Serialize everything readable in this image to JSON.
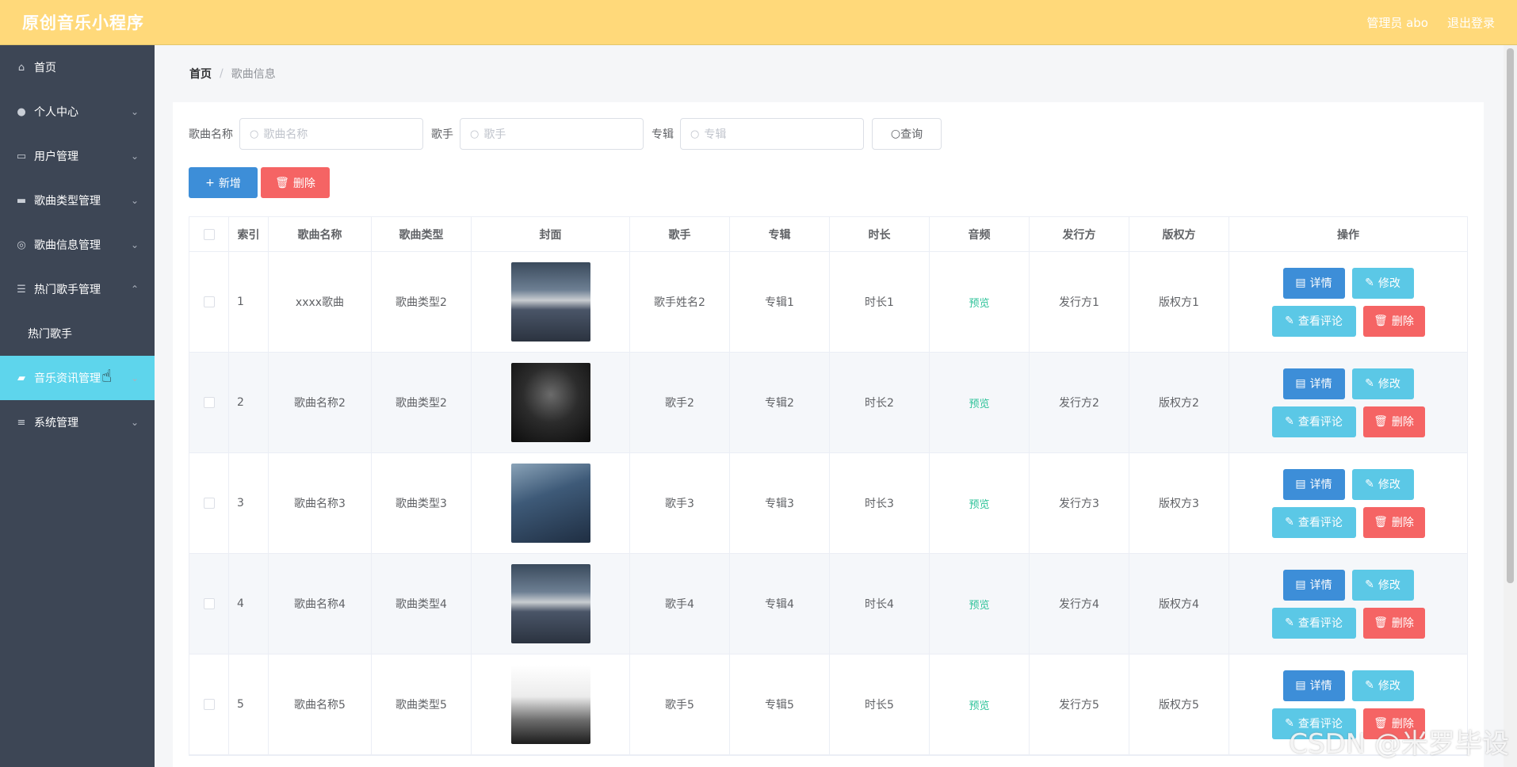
{
  "header": {
    "title": "原创音乐小程序",
    "user": "管理员 abo",
    "logout": "退出登录"
  },
  "sidebar": {
    "items": [
      {
        "label": "首页",
        "icon": "home-icon"
      },
      {
        "label": "个人中心",
        "icon": "user-icon"
      },
      {
        "label": "用户管理",
        "icon": "id-card-icon"
      },
      {
        "label": "歌曲类型管理",
        "icon": "flag-icon"
      },
      {
        "label": "歌曲信息管理",
        "icon": "compass-icon"
      },
      {
        "label": "热门歌手管理",
        "icon": "sliders-icon"
      },
      {
        "label": "音乐资讯管理",
        "icon": "wallet-icon"
      },
      {
        "label": "系统管理",
        "icon": "menu-icon"
      }
    ],
    "submenu": {
      "label": "热门歌手"
    },
    "active_item": "音乐资讯管理"
  },
  "breadcrumb": {
    "home": "首页",
    "separator": "/",
    "current": "歌曲信息"
  },
  "search": {
    "song_label": "歌曲名称",
    "song_placeholder": "歌曲名称",
    "singer_label": "歌手",
    "singer_placeholder": "歌手",
    "album_label": "专辑",
    "album_placeholder": "专辑",
    "query_button": "查询"
  },
  "actions": {
    "add": "新增",
    "delete": "删除"
  },
  "table": {
    "headers": [
      "索引",
      "歌曲名称",
      "歌曲类型",
      "封面",
      "歌手",
      "专辑",
      "时长",
      "音频",
      "发行方",
      "版权方",
      "操作"
    ],
    "rows": [
      {
        "index": "1",
        "name": "xxxx歌曲",
        "type": "歌曲类型2",
        "singer": "歌手姓名2",
        "album": "专辑1",
        "duration": "时长1",
        "audio": "预览",
        "publisher": "发行方1",
        "copyright": "版权方1"
      },
      {
        "index": "2",
        "name": "歌曲名称2",
        "type": "歌曲类型2",
        "singer": "歌手2",
        "album": "专辑2",
        "duration": "时长2",
        "audio": "预览",
        "publisher": "发行方2",
        "copyright": "版权方2"
      },
      {
        "index": "3",
        "name": "歌曲名称3",
        "type": "歌曲类型3",
        "singer": "歌手3",
        "album": "专辑3",
        "duration": "时长3",
        "audio": "预览",
        "publisher": "发行方3",
        "copyright": "版权方3"
      },
      {
        "index": "4",
        "name": "歌曲名称4",
        "type": "歌曲类型4",
        "singer": "歌手4",
        "album": "专辑4",
        "duration": "时长4",
        "audio": "预览",
        "publisher": "发行方4",
        "copyright": "版权方4"
      },
      {
        "index": "5",
        "name": "歌曲名称5",
        "type": "歌曲类型5",
        "singer": "歌手5",
        "album": "专辑5",
        "duration": "时长5",
        "audio": "预览",
        "publisher": "发行方5",
        "copyright": "版权方5"
      }
    ],
    "row_buttons": {
      "detail": "详情",
      "edit": "修改",
      "comments": "查看评论",
      "delete": "删除"
    }
  },
  "watermark": "CSDN @米罗毕设",
  "colors": {
    "topbar": "#ffd97a",
    "sidebar": "#3d4655",
    "active": "#5ed5ec",
    "primary": "#3d8ed8",
    "danger": "#f56464",
    "info": "#5bc8e6",
    "preview": "#2fc39a"
  }
}
